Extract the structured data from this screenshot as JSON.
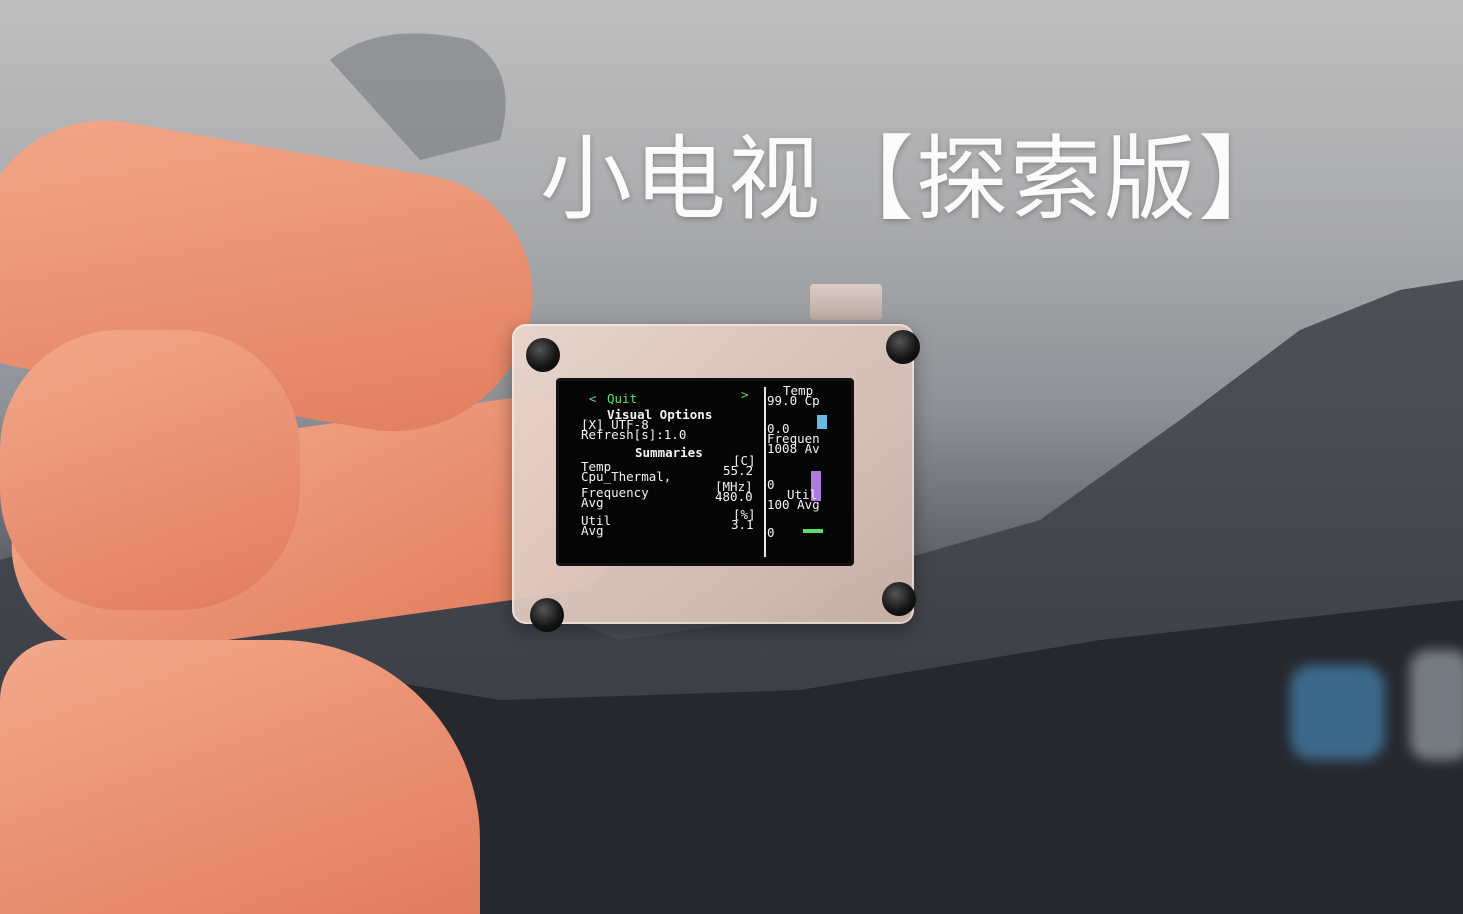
{
  "overlay": {
    "title": "小电视【探索版】"
  },
  "screen": {
    "nav_prev": "<",
    "nav_label": "Quit",
    "nav_next": ">",
    "section_visual": "Visual Options",
    "opt_utf8": "[X] UTF-8",
    "opt_refresh": "Refresh[s]:1.0",
    "section_summaries": "Summaries",
    "temp_label": "Temp",
    "temp_unit": "[C]",
    "temp_sensor": "Cpu_Thermal,",
    "temp_value": "55.2",
    "freq_label": "Frequency",
    "freq_unit": "[MHz]",
    "freq_sub": "Avg",
    "freq_value": "480.0",
    "util_label": "Util",
    "util_unit": "[%]",
    "util_sub": "Avg",
    "util_value": "3.1",
    "side_temp": "Temp",
    "side_temp_val": "99.0 Cp",
    "side_zero_1": "0.0",
    "side_freq": "Frequen",
    "side_freq_val": "1008 Av",
    "side_zero_2": "0",
    "side_util": "Util",
    "side_util_val": "100 Avg",
    "side_zero_3": "0"
  },
  "colors": {
    "accent_green": "#58e06a",
    "screen_bg": "#050505",
    "title_white": "#fbfbfb"
  }
}
